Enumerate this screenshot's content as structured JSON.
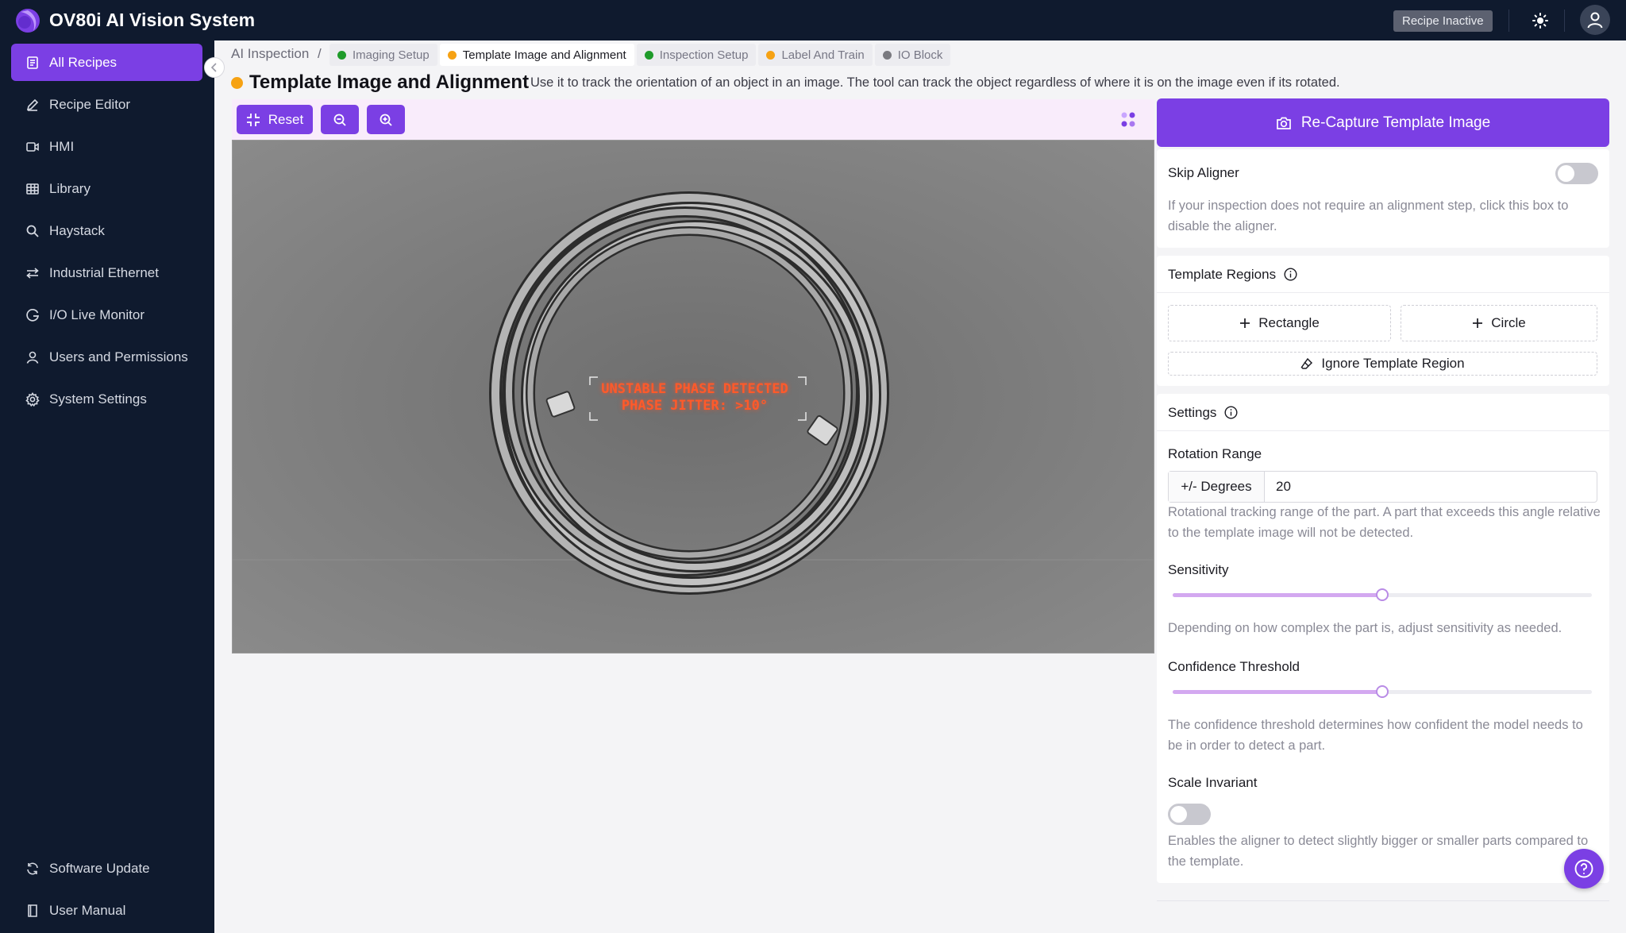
{
  "app": {
    "title": "OV80i AI Vision System",
    "status_badge": "Recipe Inactive"
  },
  "sidebar": {
    "items": [
      {
        "label": "All Recipes",
        "icon": "recipes-icon",
        "active": true
      },
      {
        "label": "Recipe Editor",
        "icon": "pencil-icon"
      },
      {
        "label": "HMI",
        "icon": "video-icon"
      },
      {
        "label": "Library",
        "icon": "grid-icon"
      },
      {
        "label": "Haystack",
        "icon": "search-icon"
      },
      {
        "label": "Industrial Ethernet",
        "icon": "ethernet-icon"
      },
      {
        "label": "I/O Live Monitor",
        "icon": "monitor-icon"
      },
      {
        "label": "Users and Permissions",
        "icon": "user-icon"
      },
      {
        "label": "System Settings",
        "icon": "gear-icon"
      }
    ],
    "footer": [
      {
        "label": "Software Update",
        "icon": "refresh-icon"
      },
      {
        "label": "User Manual",
        "icon": "book-icon"
      }
    ]
  },
  "breadcrumb": {
    "root": "AI Inspection",
    "separator": "/",
    "tabs": [
      {
        "label": "Imaging Setup",
        "status_color": "#1f9b2a"
      },
      {
        "label": "Template Image and Alignment",
        "status_color": "#f6a213",
        "active": true
      },
      {
        "label": "Inspection Setup",
        "status_color": "#1f9b2a"
      },
      {
        "label": "Label And Train",
        "status_color": "#f6a213"
      },
      {
        "label": "IO Block",
        "status_color": "#7a7a80"
      }
    ]
  },
  "page": {
    "title": "Template Image and Alignment",
    "status_color": "#f6a213",
    "description": "Use it to track the orientation of an object in an image. The tool can track the object regardless of where it is on the image even if its rotated."
  },
  "toolbar": {
    "reset_label": "Reset"
  },
  "image": {
    "overlay_line1": "UNSTABLE PHASE DETECTED",
    "overlay_line2": "PHASE JITTER: >10°"
  },
  "panel": {
    "recapture_label": "Re-Capture Template Image",
    "skip_aligner": {
      "label": "Skip Aligner",
      "enabled": false,
      "help": "If your inspection does not require an alignment step, click this box to disable the aligner."
    },
    "template_regions": {
      "title": "Template Regions",
      "rectangle_label": "Rectangle",
      "circle_label": "Circle",
      "ignore_label": "Ignore Template Region"
    },
    "settings": {
      "title": "Settings",
      "rotation": {
        "label": "Rotation Range",
        "addon": "+/- Degrees",
        "value": "20",
        "help": "Rotational tracking range of the part. A part that exceeds this angle relative to the template image will not be detected."
      },
      "sensitivity": {
        "label": "Sensitivity",
        "value_fraction": 0.5,
        "help": "Depending on how complex the part is, adjust sensitivity as needed."
      },
      "confidence": {
        "label": "Confidence Threshold",
        "value_fraction": 0.5,
        "help": "The confidence threshold determines how confident the model needs to be in order to detect a part."
      },
      "scale_invariant": {
        "label": "Scale Invariant",
        "enabled": false,
        "help": "Enables the aligner to detect slightly bigger or smaller parts compared to the template."
      }
    }
  },
  "colors": {
    "accent": "#7b3fe4",
    "sidebar_bg": "#0f1a2e",
    "toolbar_bg": "#f9ecfb"
  }
}
